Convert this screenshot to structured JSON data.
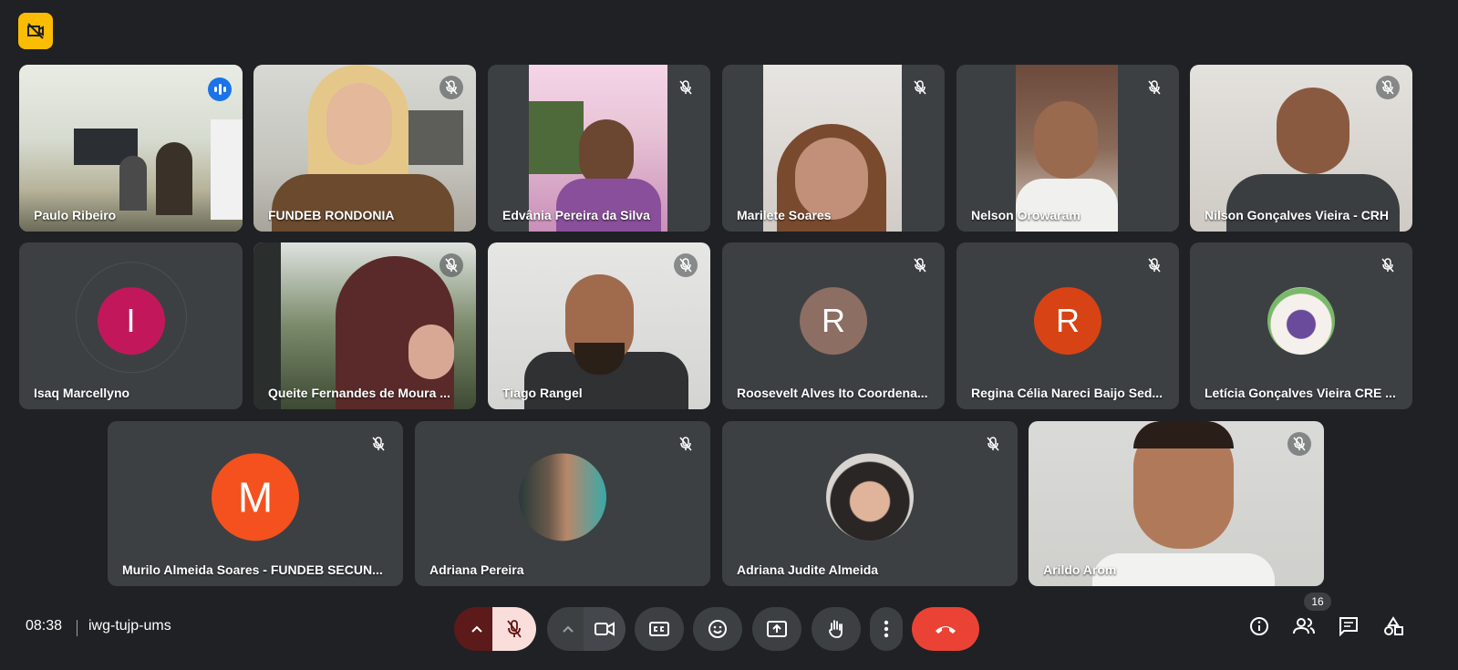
{
  "meeting": {
    "time": "08:38",
    "code": "iwg-tujp-ums",
    "participant_count": "16"
  },
  "participants": [
    {
      "name": "Paulo Ribeiro"
    },
    {
      "name": "FUNDEB RONDONIA"
    },
    {
      "name": "Edvânia Pereira da Silva"
    },
    {
      "name": "Marilete Soares"
    },
    {
      "name": "Nelson Orowaram"
    },
    {
      "name": "Nilson Gonçalves Vieira - CRH"
    },
    {
      "name": "Isaq Marcellyno",
      "initial": "I"
    },
    {
      "name": "Queite Fernandes de Moura ..."
    },
    {
      "name": "Tiago Rangel"
    },
    {
      "name": "Roosevelt Alves Ito Coordena...",
      "initial": "R"
    },
    {
      "name": "Regina Célia Nareci Baijo Sed...",
      "initial": "R"
    },
    {
      "name": "Letícia Gonçalves Vieira CRE ..."
    },
    {
      "name": "Murilo Almeida Soares - FUNDEB SECUN...",
      "initial": "M"
    },
    {
      "name": "Adriana Pereira"
    },
    {
      "name": "Adriana Judite Almeida"
    },
    {
      "name": "Arildo Arom"
    }
  ],
  "colors": {
    "background": "#202124",
    "tile": "#3c4043",
    "active_outline": "#8ab4f8",
    "end_call": "#ea4335",
    "avatar_isaq": "#c2185b",
    "avatar_roosevelt": "#8d6e63",
    "avatar_regina": "#d84315",
    "avatar_murilo": "#f4511e",
    "recording_badge": "#fbbc04"
  }
}
